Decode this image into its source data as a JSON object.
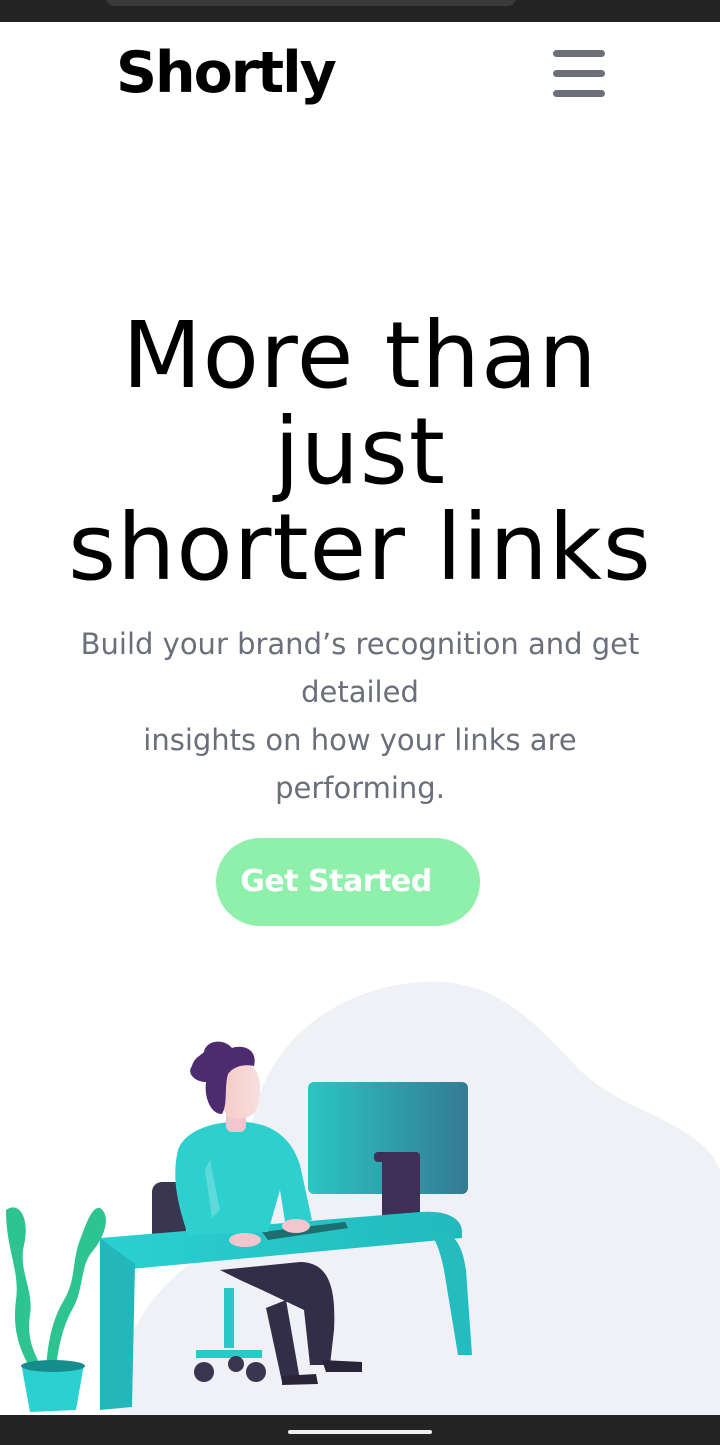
{
  "brand": {
    "name": "Shortly"
  },
  "nav": {
    "menu_icon": "hamburger-menu-icon"
  },
  "hero": {
    "title_lines": [
      "More than",
      "just",
      "shorter links"
    ],
    "subtitle_lines": [
      "Build your brand’s recognition and get",
      "detailed",
      "insights on how your links are",
      "performing."
    ],
    "cta_label": "Get Started"
  },
  "illustration": {
    "name": "person-working-illustration"
  },
  "colors": {
    "cta_background": "#8ef0aa",
    "subtitle_text": "#6b6f7b",
    "menu_icon": "#6d7079",
    "illustration_blob": "#f0f1f6",
    "desk": "#2bd0cf",
    "monitor": "#2e8c9c",
    "hair": "#4b2b6b",
    "plant": "#2dc491"
  }
}
